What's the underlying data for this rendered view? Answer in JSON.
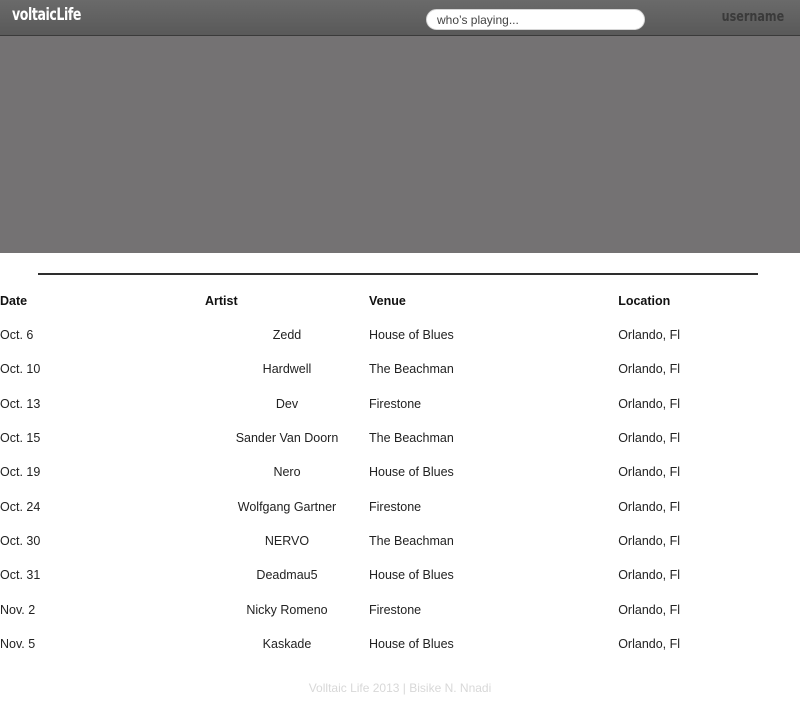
{
  "header": {
    "logo": "voltaicLife",
    "search_placeholder": "who’s playing...",
    "username": "username"
  },
  "table": {
    "columns": [
      "Date",
      "Artist",
      "Venue",
      "Location"
    ],
    "rows": [
      {
        "date": "Oct. 6",
        "artist": "Zedd",
        "venue": "House of Blues",
        "location": "Orlando, Fl"
      },
      {
        "date": "Oct. 10",
        "artist": "Hardwell",
        "venue": "The Beachman",
        "location": "Orlando, Fl"
      },
      {
        "date": "Oct. 13",
        "artist": "Dev",
        "venue": "Firestone",
        "location": "Orlando, Fl"
      },
      {
        "date": "Oct. 15",
        "artist": "Sander Van Doorn",
        "venue": "The Beachman",
        "location": "Orlando, Fl"
      },
      {
        "date": "Oct. 19",
        "artist": "Nero",
        "venue": "House of Blues",
        "location": "Orlando, Fl"
      },
      {
        "date": "Oct. 24",
        "artist": "Wolfgang Gartner",
        "venue": "Firestone",
        "location": "Orlando, Fl"
      },
      {
        "date": "Oct. 30",
        "artist": "NERVO",
        "venue": "The Beachman",
        "location": "Orlando, Fl"
      },
      {
        "date": "Oct. 31",
        "artist": "Deadmau5",
        "venue": "House of Blues",
        "location": "Orlando, Fl"
      },
      {
        "date": "Nov. 2",
        "artist": "Nicky Romeno",
        "venue": "Firestone",
        "location": "Orlando, Fl"
      },
      {
        "date": "Nov. 5",
        "artist": "Kaskade",
        "venue": "House of Blues",
        "location": "Orlando, Fl"
      }
    ]
  },
  "footer": {
    "text": "Volltaic Life 2013 | Bisike N. Nnadi"
  },
  "colors": {
    "header_bg": "#5f5f5f",
    "hero_bg": "#747273",
    "divider": "#2e2e2e",
    "footer_text": "#d8d8d8"
  }
}
